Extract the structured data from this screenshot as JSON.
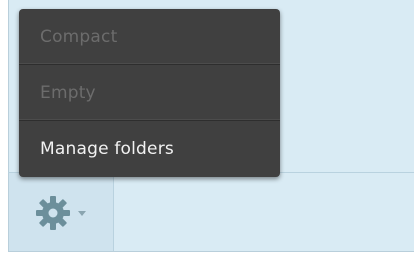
{
  "menu": {
    "items": [
      {
        "label": "Compact",
        "enabled": false
      },
      {
        "label": "Empty",
        "enabled": false
      },
      {
        "label": "Manage folders",
        "enabled": true
      }
    ]
  },
  "toolbar": {
    "settings_icon": "gear-icon",
    "dropdown_icon": "caret-down-icon"
  },
  "colors": {
    "panel_background": "#d9ebf4",
    "menu_background": "#404040",
    "menu_text": "#f2f2f2",
    "menu_text_disabled": "#6c6c6c",
    "gear_icon": "#6c8f9b"
  }
}
